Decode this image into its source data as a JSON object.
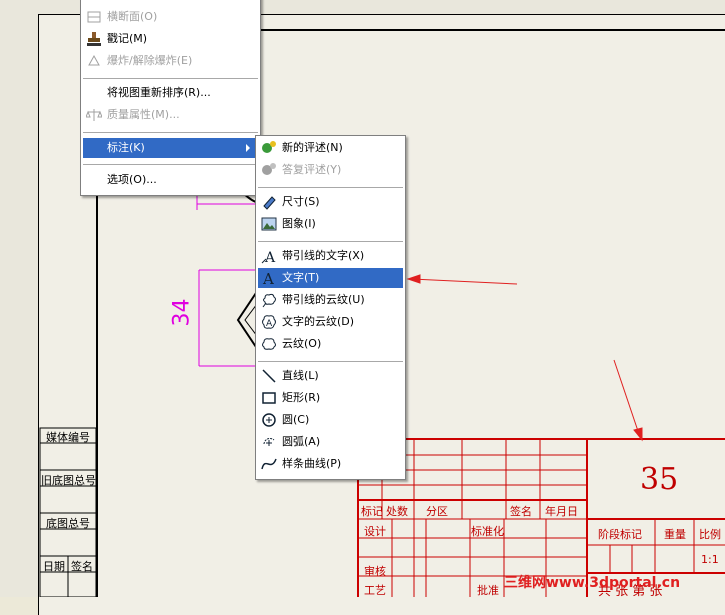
{
  "colors": {
    "border_red": "#cc0000",
    "dim_magenta": "#e000e0",
    "highlight": "#316ac5"
  },
  "main_menu": {
    "items": [
      {
        "label": "横断面(O)",
        "icon": "section-icon",
        "disabled": true
      },
      {
        "label": "戳记(M)",
        "icon": "stamp-icon",
        "disabled": false
      },
      {
        "label": "爆炸/解除爆炸(E)",
        "icon": "explode-icon",
        "disabled": true
      },
      {
        "label": "将视图重新排序(R)...",
        "icon": "",
        "disabled": false
      },
      {
        "label": "质量属性(M)...",
        "icon": "mass-icon",
        "disabled": true
      },
      {
        "label": "标注(K)",
        "icon": "",
        "disabled": false,
        "selected": true,
        "submenu": true
      },
      {
        "label": "选项(O)...",
        "icon": "",
        "disabled": false
      }
    ]
  },
  "sub_menu": {
    "items": [
      {
        "label": "新的评述(N)",
        "icon": "new-comment-icon",
        "disabled": false
      },
      {
        "label": "答复评述(Y)",
        "icon": "reply-comment-icon",
        "disabled": true
      },
      {
        "label": "尺寸(S)",
        "icon": "dimension-icon",
        "disabled": false
      },
      {
        "label": "图象(I)",
        "icon": "image-icon",
        "disabled": false
      },
      {
        "label": "带引线的文字(X)",
        "icon": "leader-text-icon",
        "disabled": false
      },
      {
        "label": "文字(T)",
        "icon": "text-icon",
        "disabled": false,
        "selected": true
      },
      {
        "label": "带引线的云纹(U)",
        "icon": "leader-cloud-icon",
        "disabled": false
      },
      {
        "label": "文字的云纹(D)",
        "icon": "text-cloud-icon",
        "disabled": false
      },
      {
        "label": "云纹(O)",
        "icon": "cloud-icon",
        "disabled": false
      },
      {
        "label": "直线(L)",
        "icon": "line-icon",
        "disabled": false
      },
      {
        "label": "矩形(R)",
        "icon": "rectangle-icon",
        "disabled": false
      },
      {
        "label": "圆(C)",
        "icon": "circle-icon",
        "disabled": false
      },
      {
        "label": "圆弧(A)",
        "icon": "arc-icon",
        "disabled": false
      },
      {
        "label": "样条曲线(P)",
        "icon": "spline-icon",
        "disabled": false
      }
    ]
  },
  "drawing": {
    "dimension_value": "34",
    "title_number": "35",
    "left_column": [
      "媒体编号",
      "旧底图总号",
      "底图总号",
      "日期",
      "签名"
    ],
    "title_block": {
      "row_labels": [
        "标记",
        "处数",
        "分区",
        "签名",
        "年月日"
      ],
      "design": "设计",
      "standardize": "标准化",
      "review": "审核",
      "craft": "工艺",
      "approve": "批准",
      "stage_mark": "阶段标记",
      "weight": "重量",
      "scale": "比例",
      "scale_value": "1:1",
      "sheets": "共  张  第  张"
    }
  },
  "watermark": "三维网www.3dportal.cn"
}
